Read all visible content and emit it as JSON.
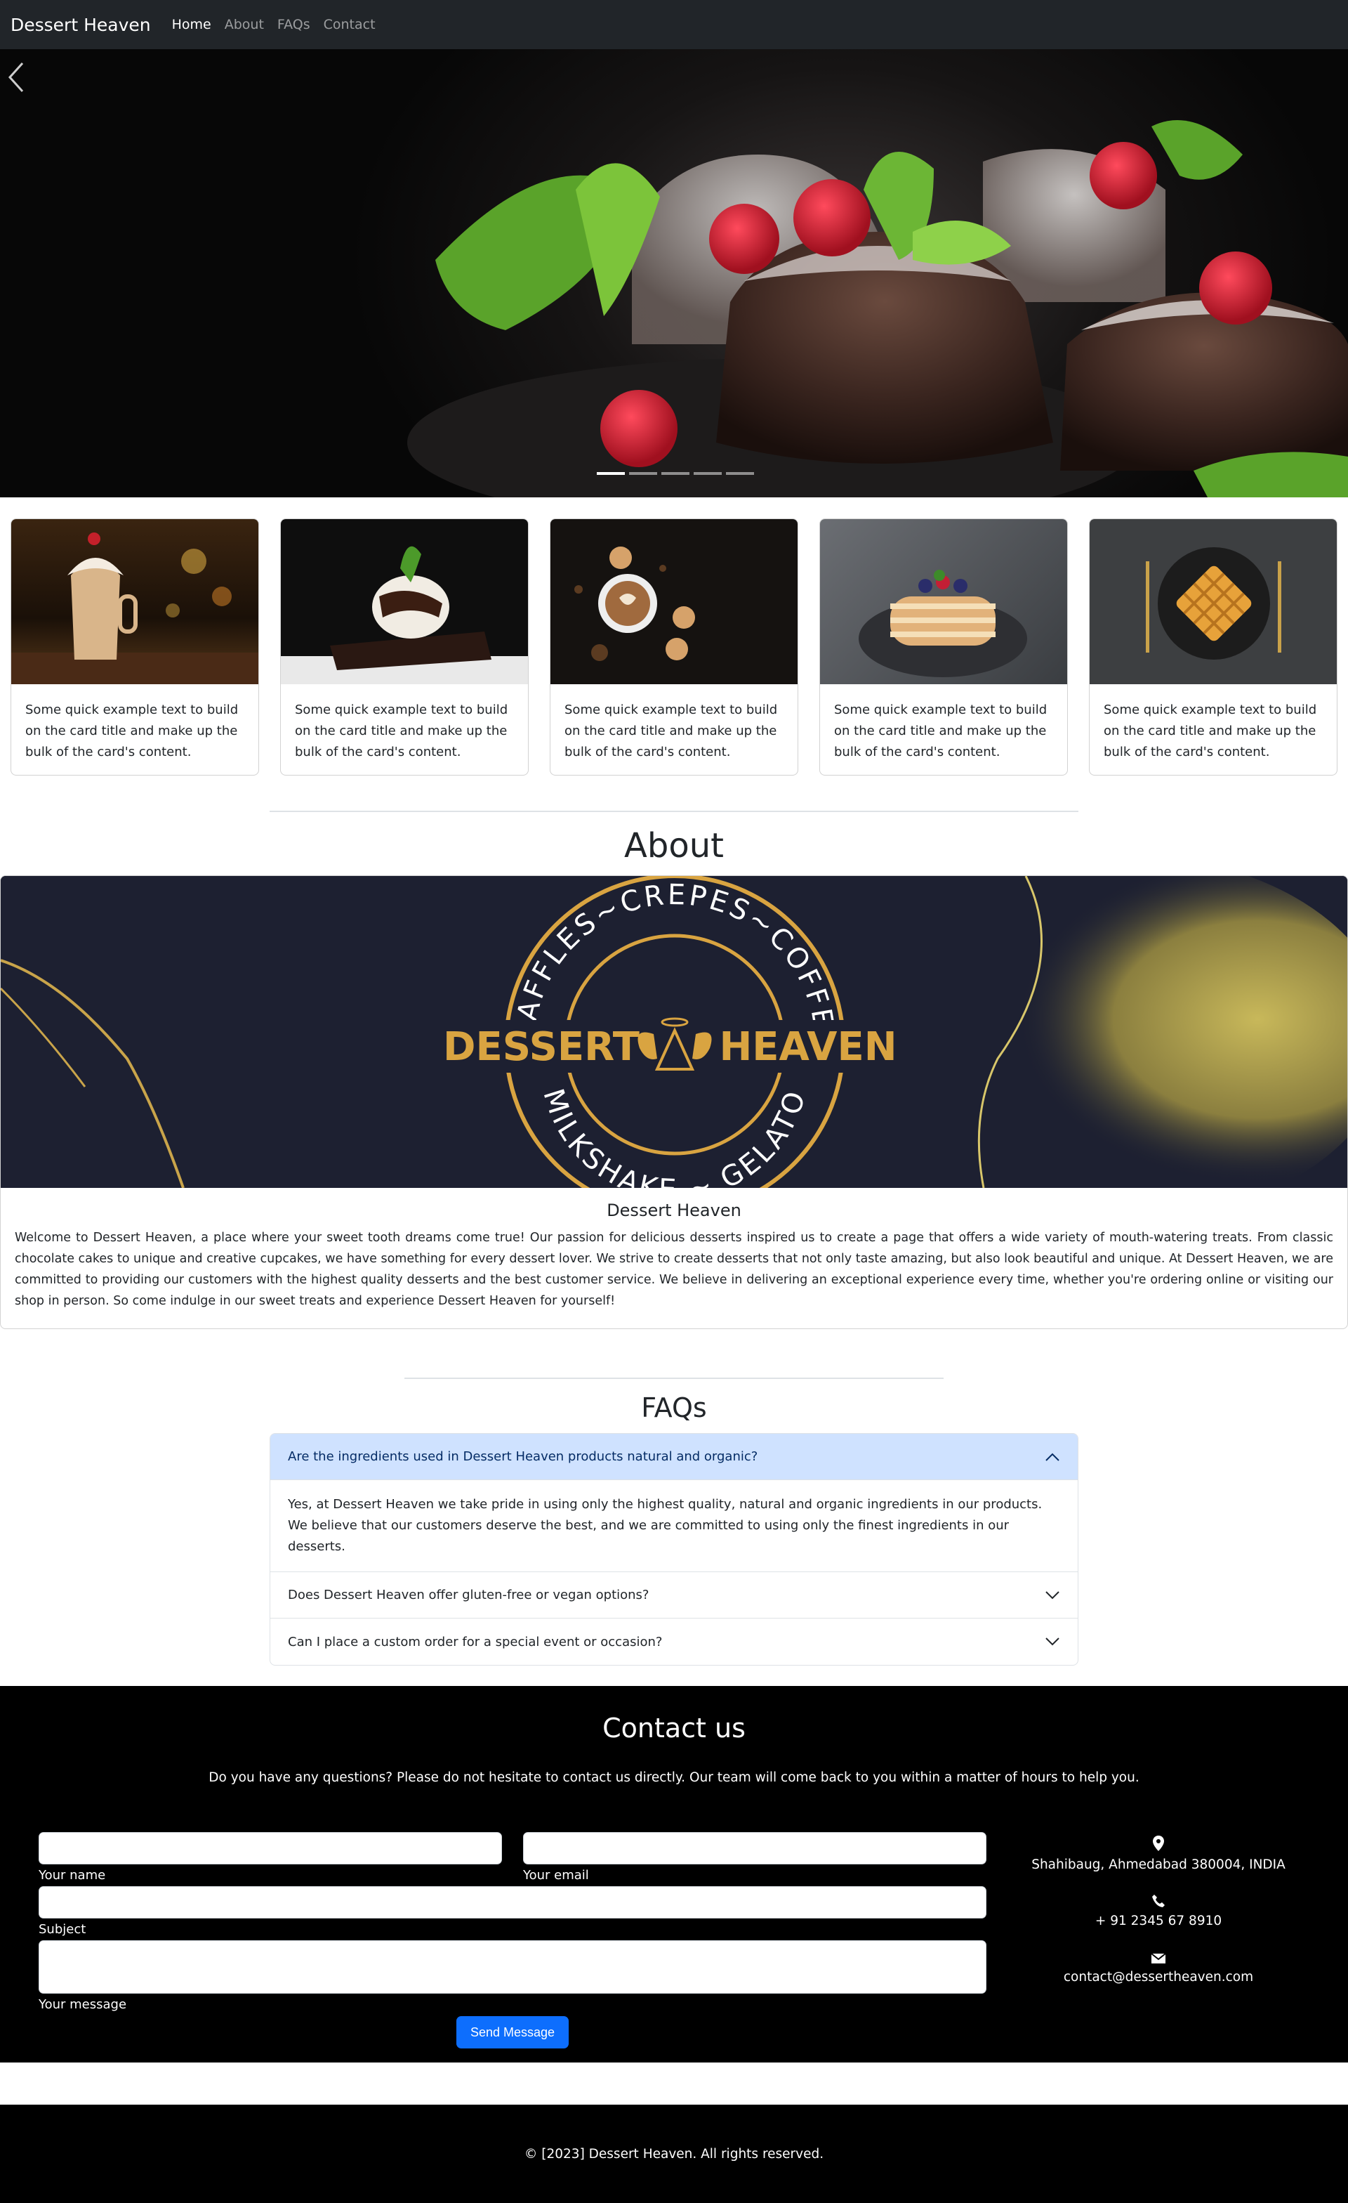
{
  "nav": {
    "brand": "Dessert Heaven",
    "links": [
      "Home",
      "About",
      "FAQs",
      "Contact"
    ]
  },
  "hero": {
    "slides": 5,
    "active_slide": 1
  },
  "cards": [
    {
      "text": "Some quick example text to build on the card title and make up the bulk of the card's content.",
      "image": "milkshake-photo"
    },
    {
      "text": "Some quick example text to build on the card title and make up the bulk of the card's content.",
      "image": "brownie-icecream-photo"
    },
    {
      "text": "Some quick example text to build on the card title and make up the bulk of the card's content.",
      "image": "coffee-cookies-photo"
    },
    {
      "text": "Some quick example text to build on the card title and make up the bulk of the card's content.",
      "image": "pancakes-photo"
    },
    {
      "text": "Some quick example text to build on the card title and make up the bulk of the card's content.",
      "image": "waffle-photo"
    }
  ],
  "about": {
    "heading": "About",
    "logo": {
      "top_text": "WAFFLES~CREPES~COFFEE",
      "bottom_text": "MILKSHAKE ~ GELATO",
      "left_word": "DESSERT",
      "right_word": "HEAVEN"
    },
    "title": "Dessert Heaven",
    "text": "Welcome to Dessert Heaven, a place where your sweet tooth dreams come true! Our passion for delicious desserts inspired us to create a page that offers a wide variety of mouth-watering treats. From classic chocolate cakes to unique and creative cupcakes, we have something for every dessert lover. We strive to create desserts that not only taste amazing, but also look beautiful and unique. At Dessert Heaven, we are committed to providing our customers with the highest quality desserts and the best customer service. We believe in delivering an exceptional experience every time, whether you're ordering online or visiting our shop in person. So come indulge in our sweet treats and experience Dessert Heaven for yourself!"
  },
  "faqs": {
    "heading": "FAQs",
    "items": [
      {
        "q": "Are the ingredients used in Dessert Heaven products natural and organic?",
        "a": "Yes, at Dessert Heaven we take pride in using only the highest quality, natural and organic ingredients in our products. We believe that our customers deserve the best, and we are committed to using only the finest ingredients in our desserts.",
        "open": true
      },
      {
        "q": "Does Dessert Heaven offer gluten-free or vegan options?",
        "open": false
      },
      {
        "q": "Can I place a custom order for a special event or occasion?",
        "open": false
      }
    ]
  },
  "contact": {
    "heading": "Contact us",
    "subtitle": "Do you have any questions? Please do not hesitate to contact us directly. Our team will come back to you within a matter of hours to help you.",
    "labels": {
      "name": "Your name",
      "email": "Your email",
      "subject": "Subject",
      "message": "Your message"
    },
    "send": "Send Message",
    "address": "Shahibaug, Ahmedabad 380004, INDIA",
    "phone": "+ 91 2345 67 8910",
    "email": "contact@dessertheaven.com"
  },
  "footer": {
    "text": "© [2023] Dessert Heaven. All rights reserved."
  },
  "colors": {
    "navbar": "#212529",
    "accent": "#0d6efd",
    "accordion_open": "#cfe2ff",
    "gold": "#d9a441"
  }
}
